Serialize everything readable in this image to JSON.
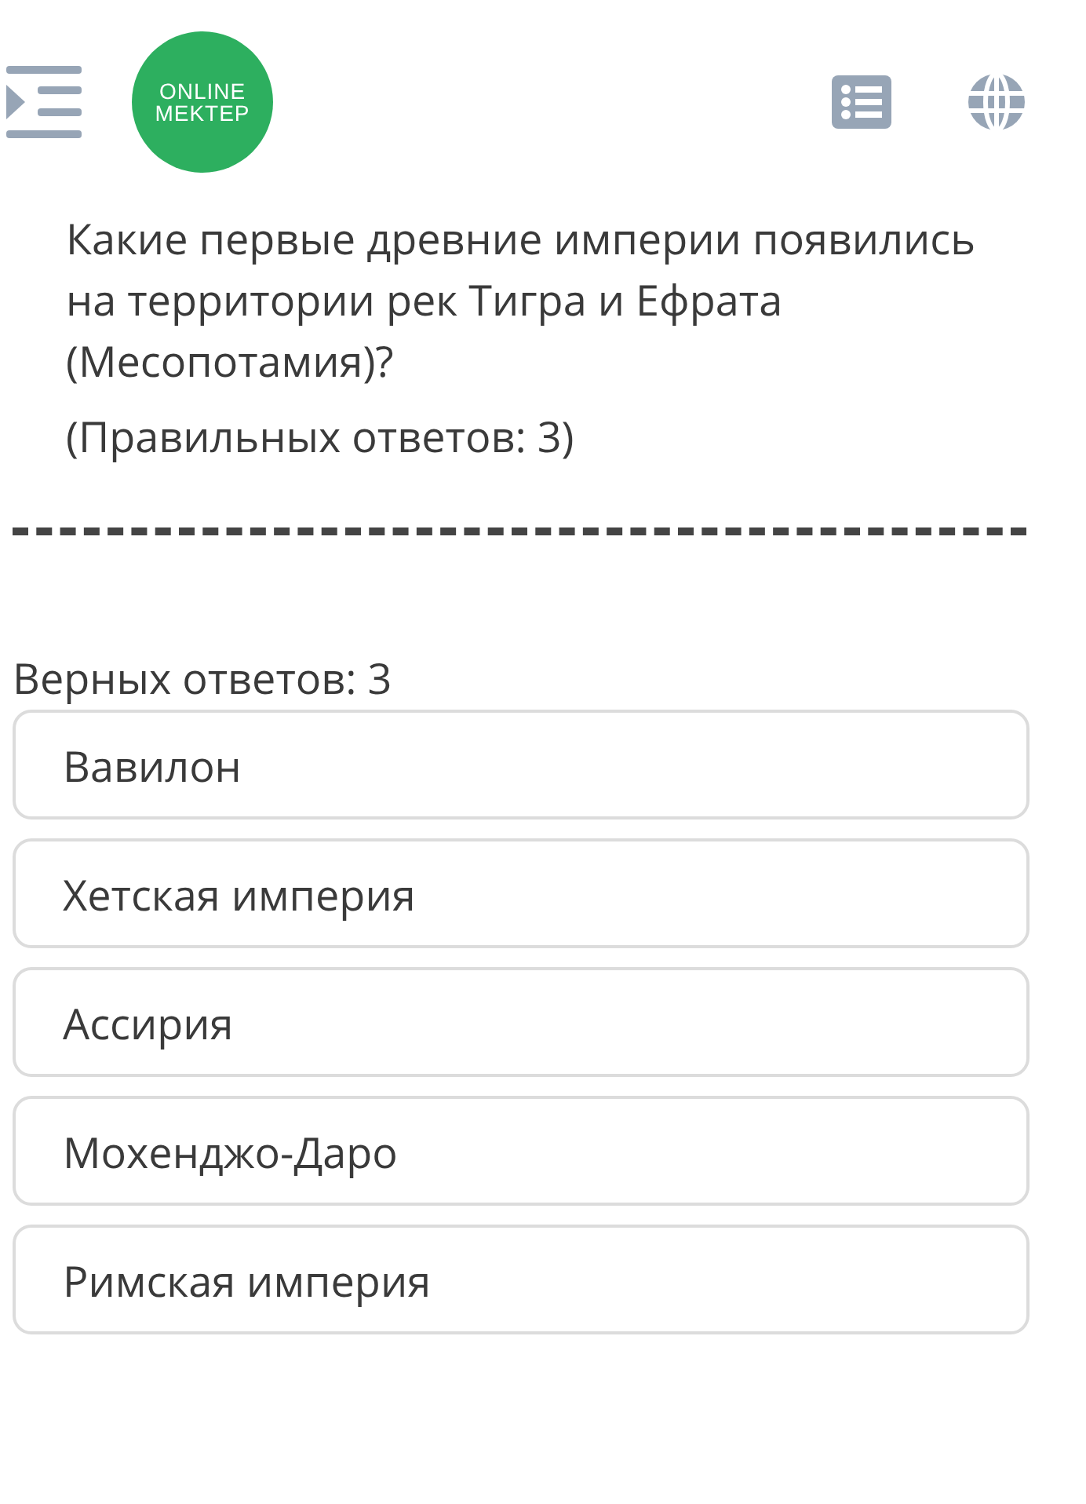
{
  "logo": {
    "line_1": "ONLINE",
    "line_2": "MEKTEP"
  },
  "question": {
    "text": "Какие первые древние империи появились на территории рек Тигра и Ефрата (Месопотамия)?",
    "hint": "(Правильных ответов: 3)"
  },
  "answers_label": "Верных ответов: 3",
  "answers": [
    {
      "label": "Вавилон"
    },
    {
      "label": "Хетская империя"
    },
    {
      "label": "Ассирия"
    },
    {
      "label": "Мохенджо-Даро"
    },
    {
      "label": "Римская империя"
    }
  ]
}
